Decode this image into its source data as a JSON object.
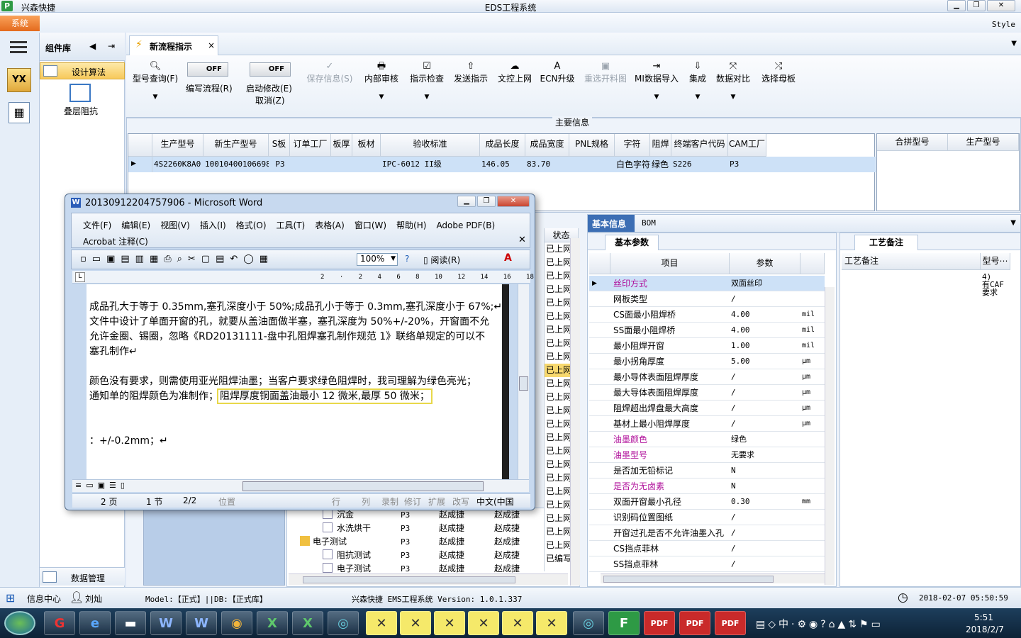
{
  "window": {
    "app_name": "兴森快捷",
    "title": "EDS工程系统"
  },
  "menu": {
    "system": "系统",
    "style": "Style"
  },
  "components": {
    "title": "组件库",
    "section": "设计算法",
    "item": "叠层阻抗",
    "bottom": "数据管理"
  },
  "tab": {
    "label": "新流程指示"
  },
  "toolbar": {
    "model_query": "型号查询(F)",
    "off": "OFF",
    "write_flow": "编写流程(R)",
    "start_modify": "启动修改(E)",
    "cancel": "取消(Z)",
    "buttons": [
      "保存信息(S)",
      "内部审核",
      "指示检查",
      "发送指示",
      "文控上网",
      "ECN升级",
      "重选开料图",
      "MI数据导入",
      "集成",
      "数据对比",
      "选择母板"
    ]
  },
  "main_info": {
    "title": "主要信息",
    "columns": [
      "生产型号",
      "新生产型号",
      "S板",
      "订单工厂",
      "板厚",
      "板材",
      "验收标准",
      "成品长度",
      "成品宽度",
      "PNL规格",
      "字符",
      "阻焊",
      "终端客户代码",
      "CAM工厂"
    ],
    "row": [
      "4S2260K8A0",
      "10010400106698",
      "P3",
      "",
      "",
      "",
      "IPC-6012 II级",
      "146.05",
      "83.70",
      "",
      "白色字符",
      "绿色",
      "S226",
      "P3"
    ],
    "right_columns": [
      "合拼型号",
      "生产型号"
    ]
  },
  "basic": {
    "tab1": "基本信息",
    "tab2": "BOM",
    "sub": "基本参数",
    "headers": [
      "项目",
      "参数"
    ],
    "rows": [
      {
        "k": "丝印方式",
        "v": "双面丝印",
        "u": "",
        "c": "#b0109b"
      },
      {
        "k": "网板类型",
        "v": "/",
        "u": "",
        "c": "#000"
      },
      {
        "k": "CS面最小阻焊桥",
        "v": "4.00",
        "u": "mil",
        "c": "#000"
      },
      {
        "k": "SS面最小阻焊桥",
        "v": "4.00",
        "u": "mil",
        "c": "#000"
      },
      {
        "k": "最小阻焊开窗",
        "v": "1.00",
        "u": "mil",
        "c": "#000"
      },
      {
        "k": "最小拐角厚度",
        "v": "5.00",
        "u": "μm",
        "c": "#000"
      },
      {
        "k": "最小导体表面阻焊厚度",
        "v": "/",
        "u": "μm",
        "c": "#000"
      },
      {
        "k": "最大导体表面阻焊厚度",
        "v": "/",
        "u": "μm",
        "c": "#000"
      },
      {
        "k": "阻焊超出焊盘最大高度",
        "v": "/",
        "u": "μm",
        "c": "#000"
      },
      {
        "k": "基材上最小阻焊厚度",
        "v": "/",
        "u": "μm",
        "c": "#000"
      },
      {
        "k": "油墨颜色",
        "v": "绿色",
        "u": "",
        "c": "#b0109b"
      },
      {
        "k": "油墨型号",
        "v": "无要求",
        "u": "",
        "c": "#b0109b"
      },
      {
        "k": "是否加无铅标记",
        "v": "N",
        "u": "",
        "c": "#000"
      },
      {
        "k": "是否为无卤素",
        "v": "N",
        "u": "",
        "c": "#b0109b"
      },
      {
        "k": "双面开窗最小孔径",
        "v": "0.30",
        "u": "mm",
        "c": "#000"
      },
      {
        "k": "识别码位置图纸",
        "v": "/",
        "u": "",
        "c": "#000"
      },
      {
        "k": "开窗过孔是否不允许油墨入孔",
        "v": "/",
        "u": "",
        "c": "#000"
      },
      {
        "k": "CS挡点菲林",
        "v": "/",
        "u": "",
        "c": "#000"
      },
      {
        "k": "SS挡点菲林",
        "v": "/",
        "u": "",
        "c": "#000"
      }
    ]
  },
  "process": {
    "tab": "工艺备注",
    "col1": "工艺备注",
    "col2": "型号⋯",
    "note": [
      "4)",
      "有CAF",
      "要求"
    ]
  },
  "status_col": {
    "title": "状态",
    "items": [
      "已上网",
      "已上网",
      "已上网",
      "已上网",
      "已上网",
      "已上网",
      "已上网",
      "已上网",
      "已上网",
      "已上网",
      "已上网",
      "已上网",
      "已上网",
      "已上网",
      "已上网",
      "已上网",
      "已上网",
      "已上网",
      "已上网",
      "已上网",
      "已上网",
      "已上网",
      "已上网",
      "已编写"
    ]
  },
  "tree": {
    "rows": [
      {
        "name": "沉金",
        "code": "P3",
        "a": "赵成捷",
        "b": "赵成捷",
        "folder": false
      },
      {
        "name": "水洗烘干",
        "code": "P3",
        "a": "赵成捷",
        "b": "赵成捷",
        "folder": false
      },
      {
        "name": "电子测试",
        "code": "P3",
        "a": "赵成捷",
        "b": "赵成捷",
        "folder": true
      },
      {
        "name": "阻抗测试",
        "code": "P3",
        "a": "赵成捷",
        "b": "赵成捷",
        "folder": false
      },
      {
        "name": "电子测试",
        "code": "P3",
        "a": "赵成捷",
        "b": "赵成捷",
        "folder": false
      }
    ]
  },
  "word": {
    "title": "20130912204757906 - Microsoft Word",
    "menus": [
      "文件(F)",
      "编辑(E)",
      "视图(V)",
      "插入(I)",
      "格式(O)",
      "工具(T)",
      "表格(A)",
      "窗口(W)",
      "帮助(H)",
      "Adobe PDF(B)"
    ],
    "menu2": "Acrobat 注释(C)",
    "zoom": "100%",
    "read": "阅读(R)",
    "lines": [
      "成品孔大于等于 0.35mm,塞孔深度小于 50%;成品孔小于等于 0.3mm,塞孔深度小于 67%;↵",
      "文件中设计了单面开窗的孔，就要从盖油面做半塞，塞孔深度为 50%+/-20%，开窗面不允",
      "允许金圈、锡圈，忽略《RD20131111-盘中孔阻焊塞孔制作规范 1》联络单规定的可以不",
      "塞孔制作↵",
      "",
      "颜色没有要求，则需使用亚光阻焊油墨；当客户要求绿色阻焊时，我司理解为绿色亮光；",
      "通知单的阻焊颜色为准制作；",
      "阻焊厚度铜面盖油最小 12 微米,最厚 50 微米；",
      "：+/-0.2mm；↵"
    ],
    "status": [
      "2 页",
      "1 节",
      "2/2",
      "位置",
      "行",
      "列",
      "录制",
      "修订",
      "扩展",
      "改写",
      "中文(中国"
    ]
  },
  "status": {
    "info_center": "信息中心",
    "user": "刘灿",
    "model": "Model:【正式】||DB:【正式库】",
    "version": "兴森快捷 EMS工程系统 Version: 1.0.1.337",
    "datetime": "2018-02-07 05:50:59"
  },
  "taskbar": {
    "time": "5:51",
    "date": "2018/2/7",
    "ime": "中"
  }
}
